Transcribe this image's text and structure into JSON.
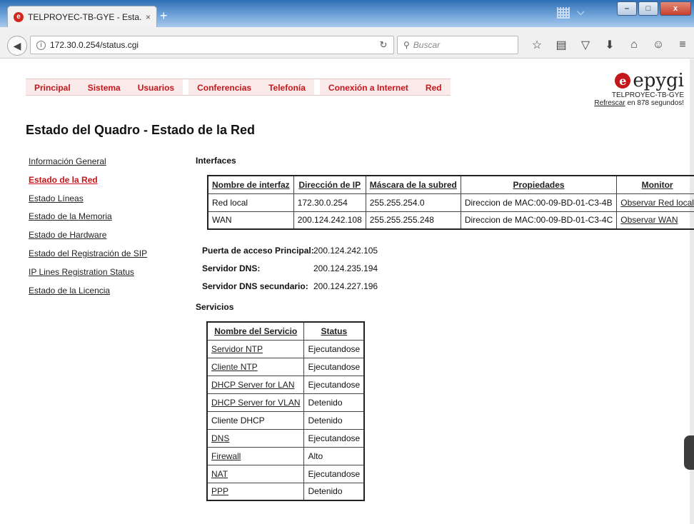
{
  "browser": {
    "tab_title": "TELPROYEC-TB-GYE - Esta...",
    "tab_close": "×",
    "new_tab": "+",
    "url": "172.30.0.254/status.cgi",
    "search_placeholder": "Buscar",
    "window_buttons": {
      "minimize": "–",
      "maximize": "□",
      "close": "x"
    }
  },
  "menu": [
    "Principal",
    "Sistema",
    "Usuarios",
    "Conferencias",
    "Telefonía",
    "Conexión a Internet",
    "Red"
  ],
  "logo": {
    "text": "epygi",
    "device_name": "TELPROYEC-TB-GYE",
    "refresh_link": "Refrescar",
    "refresh_suffix": " en 878 segundos!"
  },
  "page_title": "Estado del Quadro - Estado de la Red",
  "sidebar": [
    {
      "label": "Información General",
      "active": false
    },
    {
      "label": "Estado de la Red",
      "active": true
    },
    {
      "label": "Estado Líneas",
      "active": false
    },
    {
      "label": "Estado de la Memoria",
      "active": false
    },
    {
      "label": "Estado de Hardware",
      "active": false
    },
    {
      "label": "Estado del Registración de SIP",
      "active": false
    },
    {
      "label": "IP Lines Registration Status",
      "active": false
    },
    {
      "label": "Estado de la Licencia",
      "active": false
    }
  ],
  "interfaces": {
    "label": "Interfaces",
    "headers": [
      "Nombre de interfaz",
      "Dirección de IP",
      "Máscara de la subred",
      "Propiedades",
      "Monitor"
    ],
    "rows": [
      [
        "Red local",
        "172.30.0.254",
        "255.255.254.0",
        "Direccion de MAC:00-09-BD-01-C3-4B",
        "Observar Red local"
      ],
      [
        "WAN",
        "200.124.242.108",
        "255.255.255.248",
        "Direccion de MAC:00-09-BD-01-C3-4C",
        "Observar WAN"
      ]
    ]
  },
  "gateway": {
    "primary_label": "Puerta de acceso Principal:",
    "primary_value": "200.124.242.105",
    "dns_label": "Servidor DNS:",
    "dns_value": "200.124.235.194",
    "dns2_label": "Servidor DNS secundario:",
    "dns2_value": "200.124.227.196"
  },
  "services": {
    "label": "Servicios",
    "headers": [
      "Nombre del Servicio",
      "Status"
    ],
    "rows": [
      {
        "name": "Servidor NTP",
        "link": true,
        "status": "Ejecutandose"
      },
      {
        "name": "Cliente NTP",
        "link": true,
        "status": "Ejecutandose"
      },
      {
        "name": "DHCP Server for LAN",
        "link": true,
        "status": "Ejecutandose"
      },
      {
        "name": "DHCP Server for VLAN",
        "link": true,
        "status": "Detenido"
      },
      {
        "name": "Cliente DHCP",
        "link": false,
        "status": "Detenido"
      },
      {
        "name": "DNS",
        "link": true,
        "status": "Ejecutandose"
      },
      {
        "name": "Firewall",
        "link": true,
        "status": "Alto"
      },
      {
        "name": "NAT",
        "link": true,
        "status": "Ejecutandose"
      },
      {
        "name": "PPP",
        "link": true,
        "status": "Detenido"
      }
    ]
  }
}
